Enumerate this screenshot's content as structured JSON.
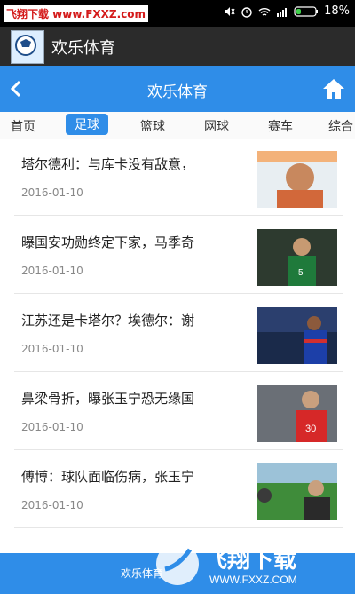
{
  "statusbar": {
    "watermark": "飞翔下载 www.FXXZ.com",
    "battery": "18%"
  },
  "app": {
    "title": "欢乐体育"
  },
  "header": {
    "title": "欢乐体育"
  },
  "tabs": [
    {
      "label": "首页"
    },
    {
      "label": "足球"
    },
    {
      "label": "篮球"
    },
    {
      "label": "网球"
    },
    {
      "label": "赛车"
    },
    {
      "label": "综合"
    }
  ],
  "articles": [
    {
      "title": "塔尔德利：与库卡没有敌意，",
      "date": "2016-01-10"
    },
    {
      "title": "曝国安功勋终定下家，马季奇",
      "date": "2016-01-10"
    },
    {
      "title": "江苏还是卡塔尔？埃德尔：谢",
      "date": "2016-01-10"
    },
    {
      "title": "鼻梁骨折，曝张玉宁恐无缘国",
      "date": "2016-01-10"
    },
    {
      "title": "傅博：球队面临伤病，张玉宁",
      "date": "2016-01-10"
    }
  ],
  "footer": {
    "text": "欢乐体育"
  },
  "watermark_bottom": {
    "text": "飞翔下载",
    "url": "WWW.FXXZ.COM"
  },
  "colors": {
    "primary": "#2f8de8"
  }
}
